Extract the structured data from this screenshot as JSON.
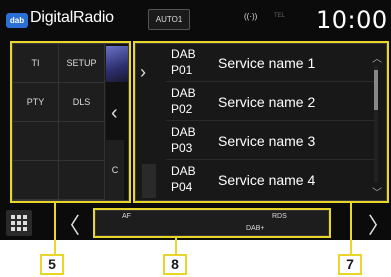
{
  "header": {
    "logo_text": "dab",
    "title": "DigitalRadio",
    "source_button": "AUTO1",
    "signal_icon": "((·))",
    "tel_label": "TEL",
    "clock": "10:00"
  },
  "left_panel": {
    "buttons": [
      "TI",
      "SETUP",
      "PTY",
      "DLS"
    ],
    "collapse_icon": "‹",
    "mini_label": "C"
  },
  "presets": {
    "nav_icon": "›",
    "rows": [
      {
        "band": "DAB",
        "num": "P01",
        "name": "Service name 1"
      },
      {
        "band": "DAB",
        "num": "P02",
        "name": "Service name 2"
      },
      {
        "band": "DAB",
        "num": "P03",
        "name": "Service name 3"
      },
      {
        "band": "DAB",
        "num": "P04",
        "name": "Service name 4"
      }
    ],
    "scroll_up_icon": "︿",
    "scroll_down_icon": "﹀",
    "scroll_position_fraction": 0.05
  },
  "bottom_bar": {
    "prev_icon": "〈",
    "next_icon": "〉",
    "af": "AF",
    "rds": "RDS",
    "dab_plus": "DAB+"
  },
  "callouts": {
    "left": "5",
    "center": "8",
    "right": "7"
  },
  "colors": {
    "highlight": "#e8d62a",
    "background": "#0b0b0b",
    "logo": "#2a6fd6"
  }
}
